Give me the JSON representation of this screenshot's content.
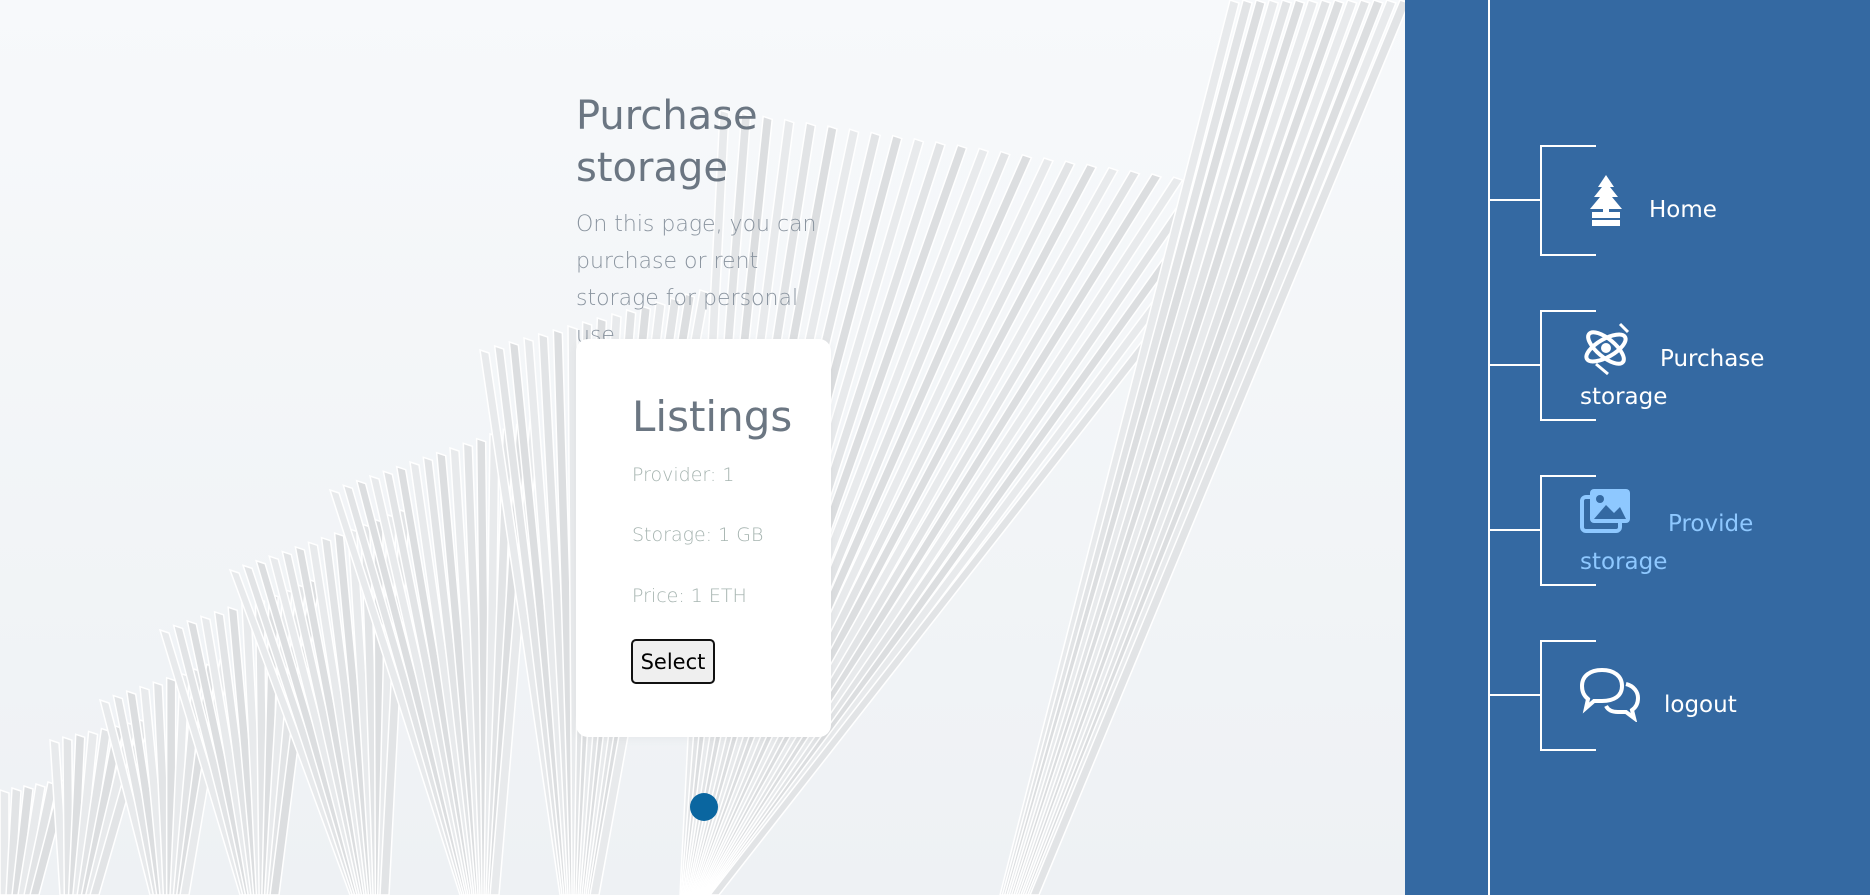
{
  "header": {
    "title": "Purchase storage",
    "description": "On this page, you can purchase or rent storage for personal use"
  },
  "listing_card": {
    "title": "Listings",
    "provider": "Provider: 1",
    "storage": "Storage: 1 GB",
    "price": "Price: 1 ETH",
    "select_label": "Select"
  },
  "pager": {
    "active_page": 1,
    "dot_color": "#0a66a0"
  },
  "sidebar": {
    "background": "#3469a2",
    "items": [
      {
        "label": "Home",
        "icon": "tree-icon",
        "active": false
      },
      {
        "label": "Purchase storage",
        "icon": "atom-icon",
        "active": false
      },
      {
        "label": "Provide storage",
        "icon": "images-icon",
        "active": true
      },
      {
        "label": "logout",
        "icon": "chat-bubbles-icon",
        "active": false
      }
    ]
  }
}
